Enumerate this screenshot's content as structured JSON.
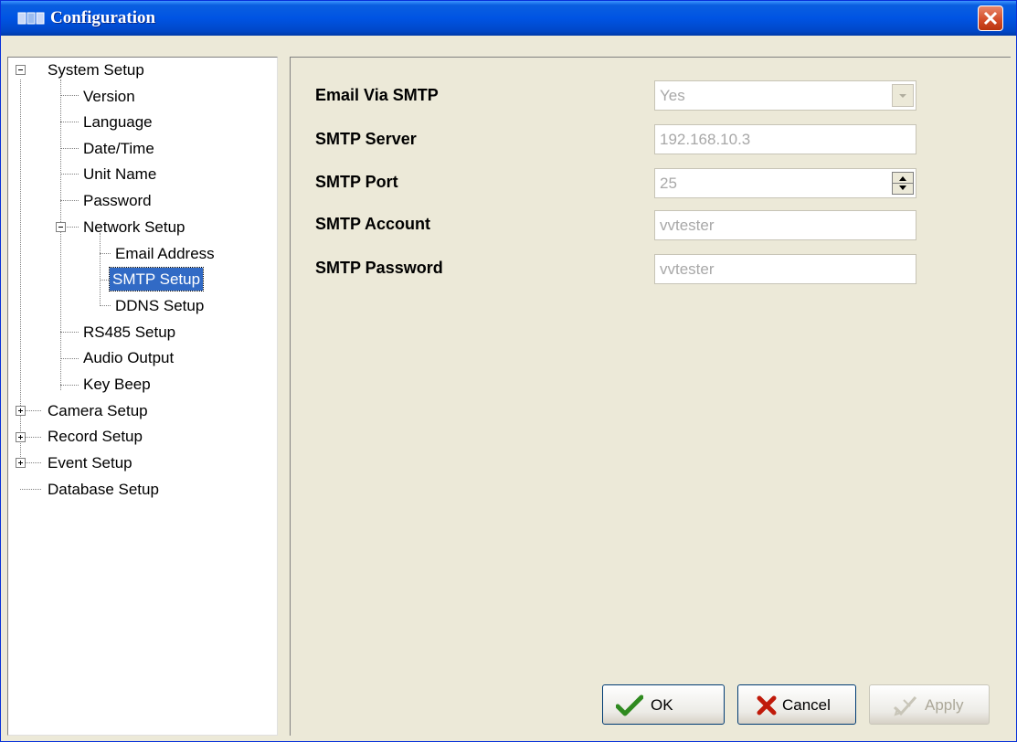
{
  "window": {
    "title": "Configuration"
  },
  "tree": {
    "system_setup": "System Setup",
    "version": "Version",
    "language": "Language",
    "date_time": "Date/Time",
    "unit_name": "Unit Name",
    "password": "Password",
    "network_setup": "Network Setup",
    "email_address": "Email Address",
    "smtp_setup": "SMTP Setup",
    "ddns_setup": "DDNS Setup",
    "rs485_setup": "RS485 Setup",
    "audio_output": "Audio Output",
    "key_beep": "Key Beep",
    "camera_setup": "Camera Setup",
    "record_setup": "Record Setup",
    "event_setup": "Event Setup",
    "database_setup": "Database Setup",
    "selected": "SMTP Setup"
  },
  "form": {
    "email_via_smtp": {
      "label": "Email Via SMTP",
      "value": "Yes"
    },
    "smtp_server": {
      "label": "SMTP Server",
      "value": "192.168.10.3"
    },
    "smtp_port": {
      "label": "SMTP Port",
      "value": "25"
    },
    "smtp_account": {
      "label": "SMTP Account",
      "value": "vvtester"
    },
    "smtp_password": {
      "label": "SMTP Password",
      "value": "vvtester"
    }
  },
  "buttons": {
    "ok": "OK",
    "cancel": "Cancel",
    "apply": "Apply"
  },
  "colors": {
    "title_bar": "#0054e3",
    "selection": "#316ac5",
    "panel": "#ece9d8"
  }
}
